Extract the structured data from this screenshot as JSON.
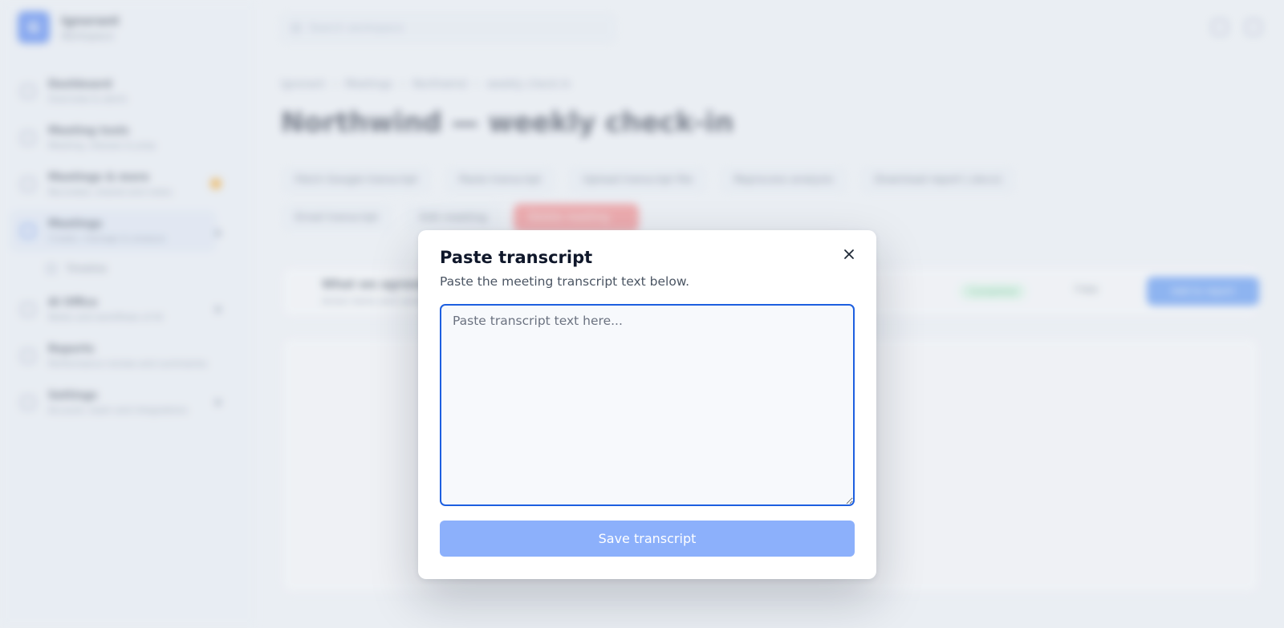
{
  "app": {
    "brand_initial": "G",
    "brand_name": "Ignorant",
    "brand_sub": "Workspace"
  },
  "sidebar": {
    "items": [
      {
        "label": "Dashboard",
        "desc": "Overview & alerts"
      },
      {
        "label": "Meeting tools",
        "desc": "Meeting, inboxes & prep"
      },
      {
        "label": "Meetings & more",
        "desc": "Recorded, shared and notes"
      },
      {
        "label": "Meetings",
        "desc": "Create, manage & analyse"
      },
      {
        "label": "AI Office",
        "desc": "Notes and workflows of AI"
      },
      {
        "label": "Reports",
        "desc": "Performance review and summaries"
      },
      {
        "label": "Settings",
        "desc": "Account, team and integrations"
      }
    ],
    "sub_item": "Timeline"
  },
  "topbar": {
    "search_placeholder": "Search workspace"
  },
  "page": {
    "breadcrumb": [
      "Ignorant",
      "Meetings",
      "Northwind",
      "weekly check-in"
    ],
    "title": "Northwind — weekly check-in",
    "tabs": [
      "Fetch Google transcript",
      "Paste transcript",
      "Upload transcript file",
      "Reprocess analysis",
      "Download report (.docx)"
    ],
    "actions": [
      "Email transcript",
      "Edit meeting",
      "Delete meeting"
    ],
    "summary": {
      "title": "What we agreed",
      "sub": "Action items and summary",
      "status": "Completed",
      "link": "Copy",
      "button": "Add to report"
    }
  },
  "modal": {
    "title": "Paste transcript",
    "subtitle": "Paste the meeting transcript text below.",
    "textarea_placeholder": "Paste transcript text here...",
    "textarea_value": "",
    "save_label": "Save transcript",
    "close_glyph": "×"
  },
  "colors": {
    "accent": "#1d5fe0",
    "save_button_disabled": "#8cb0fb",
    "danger": "#f87171"
  }
}
